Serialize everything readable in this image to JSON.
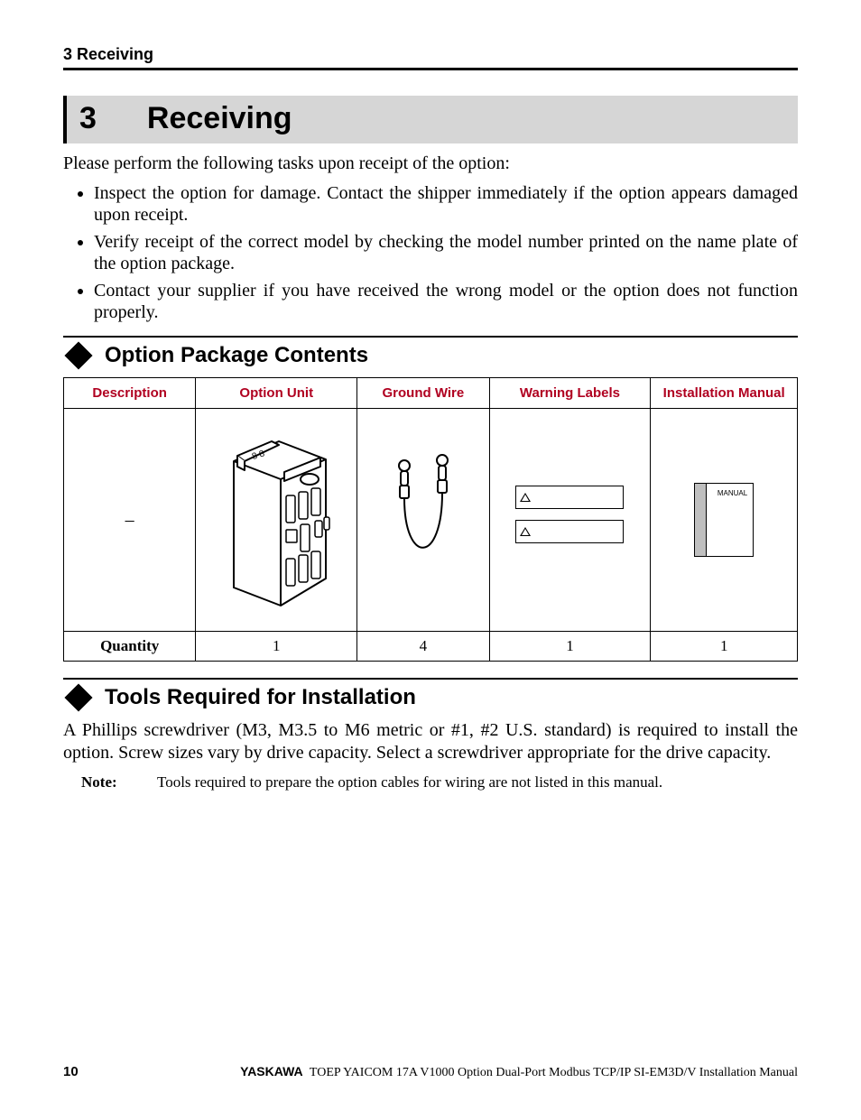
{
  "running_header": "3  Receiving",
  "chapter": {
    "num": "3",
    "title": "Receiving"
  },
  "intro": "Please perform the following tasks upon receipt of the option:",
  "bullets": [
    "Inspect the option for damage. Contact the shipper immediately if the option appears damaged upon receipt.",
    "Verify receipt of the correct model by checking the model number printed on the name plate of the option package.",
    "Contact your supplier if you have received the wrong model or the option does not function properly."
  ],
  "section1": {
    "title": "Option Package Contents",
    "headers": [
      "Description",
      "Option Unit",
      "Ground Wire",
      "Warning Labels",
      "Installation Manual"
    ],
    "desc_placeholder": "–",
    "manual_text": "MANUAL",
    "qty_label": "Quantity",
    "qty": [
      "1",
      "4",
      "1",
      "1"
    ]
  },
  "section2": {
    "title": "Tools Required for Installation",
    "body": "A Phillips screwdriver (M3, M3.5 to M6 metric or #1, #2 U.S. standard) is required to install the option. Screw sizes vary by drive capacity. Select a screwdriver appropriate for the drive capacity.",
    "note_label": "Note:",
    "note_text": "Tools required to prepare the option cables for wiring are not listed in this manual."
  },
  "footer": {
    "page": "10",
    "brand": "YASKAWA",
    "doc": " TOEP YAICOM 17A V1000 Option Dual-Port Modbus TCP/IP SI-EM3D/V Installation Manual"
  }
}
